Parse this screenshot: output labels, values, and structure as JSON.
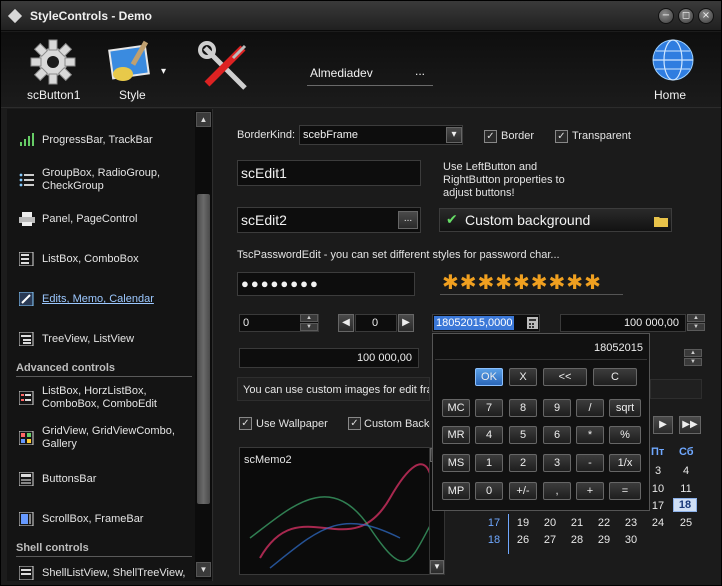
{
  "window": {
    "title": "StyleControls - Demo",
    "min_glyph": "−",
    "max_glyph": "◻",
    "close_glyph": "×"
  },
  "toolbar": {
    "button1_label": "scButton1",
    "style_label": "Style",
    "style_arrow": "▾",
    "edit_text": "Almediadev",
    "edit_dots": "...",
    "home_label": "Home"
  },
  "sidebar": {
    "items": [
      {
        "label": "ProgressBar, TrackBar",
        "icon": "bars-icon"
      },
      {
        "label": "GroupBox, RadioGroup,\nCheckGroup",
        "icon": "list-icon"
      },
      {
        "label": "Panel, PageControl",
        "icon": "printer-icon"
      },
      {
        "label": "ListBox, ComboBox",
        "icon": "listbox-icon"
      },
      {
        "label": "Edits, Memo, Calendar",
        "icon": "edit-icon"
      },
      {
        "label": "TreeView, ListView",
        "icon": "tree-icon"
      }
    ],
    "group1": "Advanced controls",
    "adv_items": [
      {
        "label": "ListBox, HorzListBox,\nComboBox, ComboEdit",
        "icon": "listbox-icon"
      },
      {
        "label": "GridView, GridViewCombo,\nGallery",
        "icon": "grid-icon"
      },
      {
        "label": "ButtonsBar",
        "icon": "buttonsbar-icon"
      },
      {
        "label": "ScrollBox, FrameBar",
        "icon": "scrollbox-icon"
      }
    ],
    "group2": "Shell controls",
    "shell_items": [
      {
        "label": "ShellListView, ShellTreeView,",
        "icon": "shell-icon"
      }
    ]
  },
  "main": {
    "borderkind_label": "BorderKind:",
    "borderkind_value": "scebFrame",
    "border_check": "Border",
    "transparent_check": "Transparent",
    "edit1": "scEdit1",
    "edit2": "scEdit2",
    "hint": "Use LeftButton and\nRightButton properties to\nadjust buttons!",
    "custom_bg": "Custom background",
    "password_label": "TscPasswordEdit - you can set different styles for password char...",
    "password_dots": "●●●●●●●●",
    "password_stars": "✱✱✱✱✱✱✱✱✱",
    "spin1": "0",
    "spin2": "0",
    "date_value": "18052015,0000",
    "currency1": "100 000,00",
    "currency2": "100 000,00",
    "custom_images": "You can use custom images for edit fran",
    "use_wallpaper": "Use Wallpaper",
    "custom_backg": "Custom Backg",
    "memo_label": "scMemo2"
  },
  "calc": {
    "display": "18052015",
    "row1": [
      "OK",
      "X",
      "<<",
      "C"
    ],
    "row2": [
      "MC",
      "7",
      "8",
      "9",
      "/",
      "sqrt"
    ],
    "row3": [
      "MR",
      "4",
      "5",
      "6",
      "*",
      "%"
    ],
    "row4": [
      "MS",
      "1",
      "2",
      "3",
      "-",
      "1/x"
    ],
    "row5": [
      "MP",
      "0",
      "+/-",
      ",",
      "+",
      "="
    ]
  },
  "calendar": {
    "head_fri": "Пт",
    "head_sat": "Сб",
    "rows": [
      [
        "3",
        "4"
      ],
      [
        "10",
        "11"
      ],
      [
        "17",
        "18"
      ],
      [
        "24",
        "25"
      ]
    ],
    "bottom1": [
      "17",
      "19",
      "20",
      "21",
      "22",
      "23",
      "24",
      "25"
    ],
    "bottom2": [
      "18",
      "26",
      "27",
      "28",
      "29",
      "30"
    ],
    "selected": "18",
    "accent": "#6fa8ff"
  }
}
